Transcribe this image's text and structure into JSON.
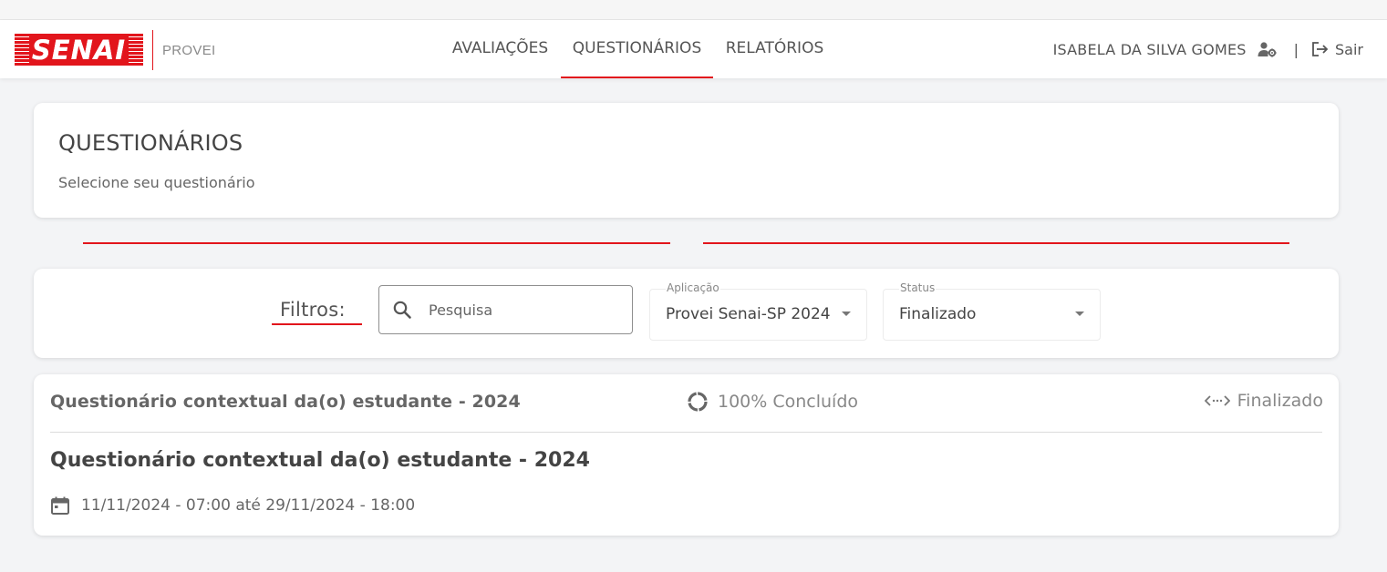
{
  "brand": {
    "logo_text": "SENAI",
    "product": "PROVEI",
    "accent": "#e2151c"
  },
  "nav": {
    "items": [
      {
        "label": "AVALIAÇÕES",
        "active": false
      },
      {
        "label": "QUESTIONÁRIOS",
        "active": true
      },
      {
        "label": "RELATÓRIOS",
        "active": false
      }
    ]
  },
  "user": {
    "name": "ISABELA DA SILVA GOMES",
    "separator": "|",
    "logout_label": "Sair"
  },
  "page": {
    "title": "QUESTIONÁRIOS",
    "subtitle": "Selecione seu questionário"
  },
  "filters": {
    "label": "Filtros:",
    "search": {
      "placeholder": "Pesquisa",
      "value": ""
    },
    "aplicacao": {
      "label": "Aplicação",
      "value": "Provei Senai-SP 2024"
    },
    "status": {
      "label": "Status",
      "value": "Finalizado"
    }
  },
  "questionnaire": {
    "header_title": "Questionário contextual da(o) estudante - 2024",
    "progress_text": "100% Concluído",
    "status_text": "Finalizado",
    "title": "Questionário contextual da(o) estudante - 2024",
    "date_range": "11/11/2024 - 07:00 até 29/11/2024 - 18:00"
  }
}
